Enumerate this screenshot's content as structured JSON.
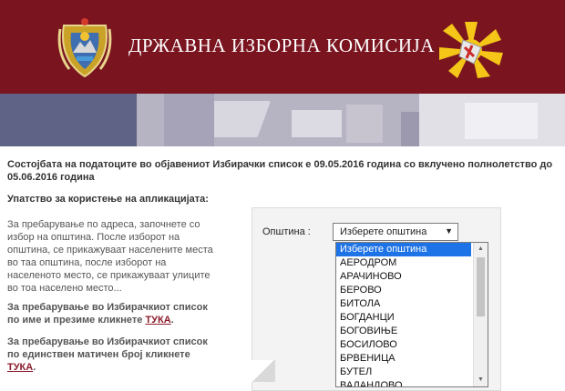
{
  "header": {
    "title": "ДРЖАВНА ИЗБОРНА КОМИСИЈА",
    "brand_color": "#7a1520"
  },
  "status_text": "Состојбата на податоците во објавениот Избирачки список е 09.05.2016 година со вклучено полнолетство до 05.06.2016 година",
  "instructions": {
    "title": "Упатство за користење на апликацијата:",
    "address_text": "За пребарување по адреса, започнете со избор на општина. После изборот на општина, се прикажуваат населените места во таа општина, после изборот на населеното место, се прикажуваат улиците во тоа населено место...",
    "by_name_text": "За пребарување во Избирачкиот список по име и презиме кликнете",
    "by_id_text": "За пребарување во Избирачкиот список по единствен матичен број кликнете",
    "link_label": "ТУКА"
  },
  "form": {
    "municipality_label": "Општина :",
    "selected": "Изберете општина",
    "options": [
      "Изберете општина",
      "АЕРОДРОМ",
      "АРАЧИНОВО",
      "БЕРОВО",
      "БИТОЛА",
      "БОГДАНЦИ",
      "БОГОВИЊЕ",
      "БОСИЛОВО",
      "БРВЕНИЦА",
      "БУТЕЛ",
      "ВАЛАНДОВО"
    ]
  },
  "icons": {
    "coat_of_arms": "coat-of-arms-icon",
    "election_logo": "election-sun-logo-icon",
    "dropdown_arrow": "caret-down-icon"
  }
}
